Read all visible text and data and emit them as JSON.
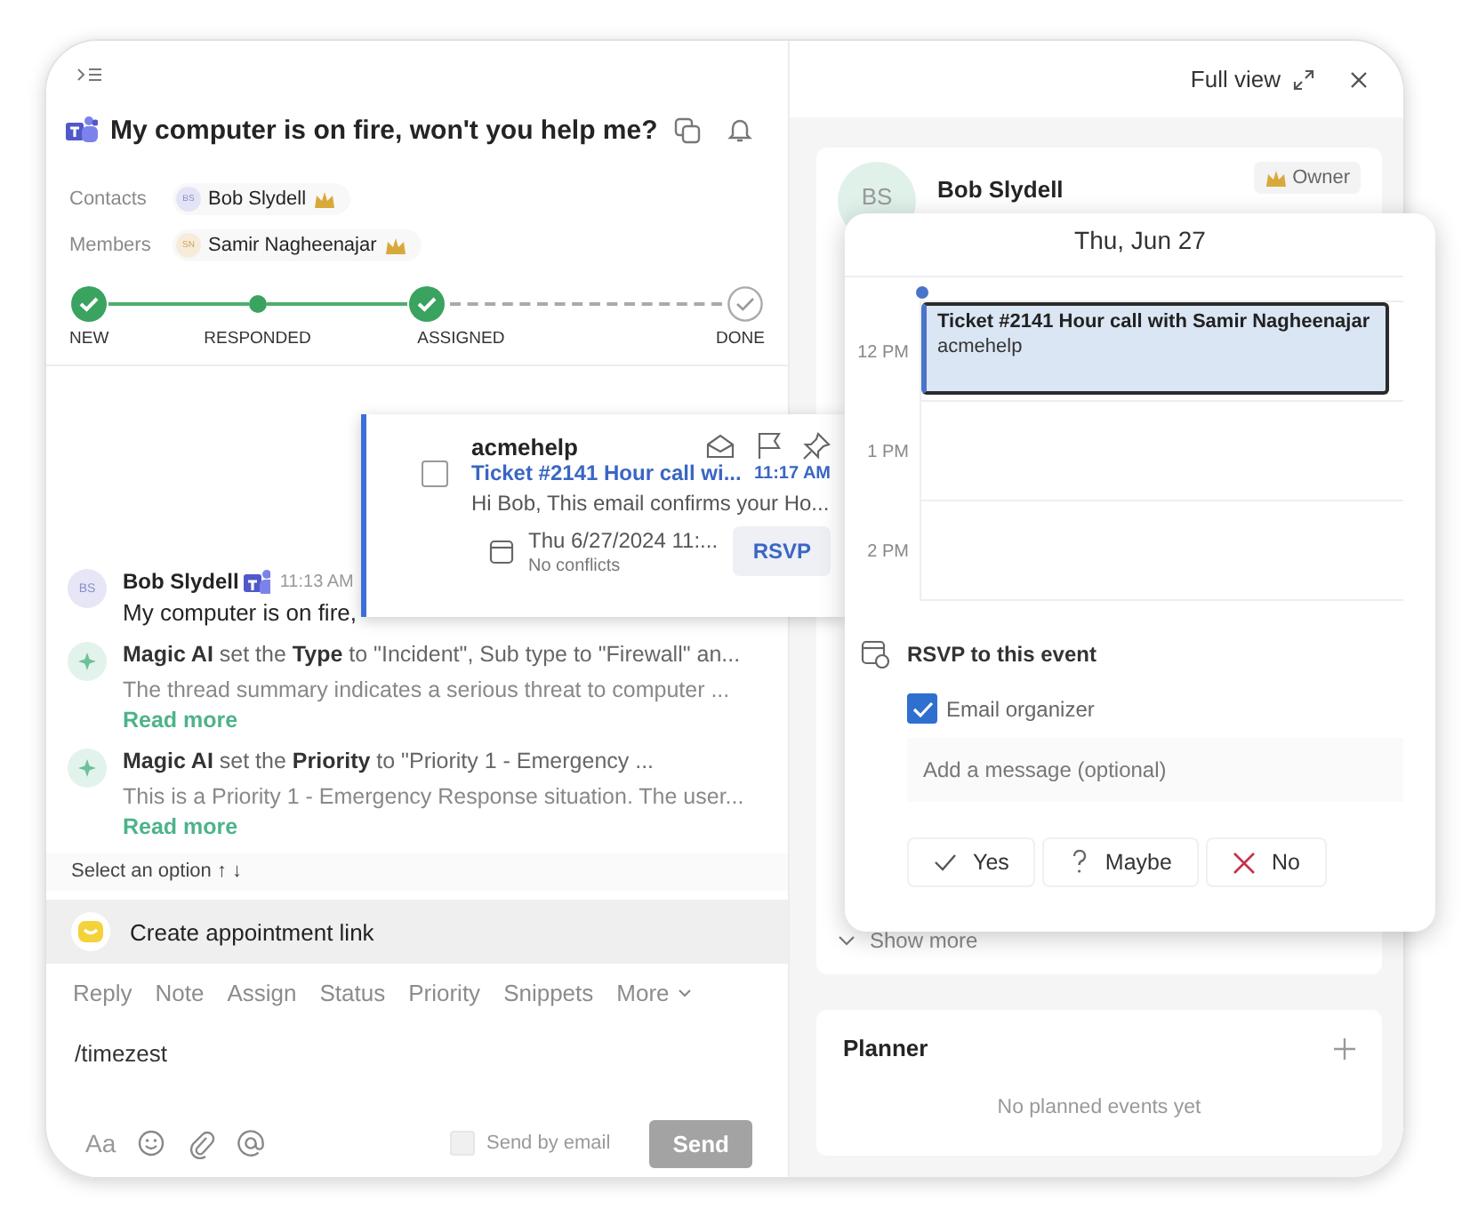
{
  "ticket": {
    "title": "My computer is on fire, won't you help me?",
    "people": [
      {
        "label": "Contacts",
        "initials": "BS",
        "name": "Bob Slydell"
      },
      {
        "label": "Members",
        "initials": "SN",
        "name": "Samir Nagheenajar"
      }
    ],
    "steps": [
      {
        "label": "NEW",
        "kind": "check"
      },
      {
        "label": "RESPONDED",
        "kind": "dot"
      },
      {
        "label": "ASSIGNED",
        "kind": "check"
      },
      {
        "label": "DONE",
        "kind": "pending"
      }
    ]
  },
  "messages": [
    {
      "kind": "user",
      "initials": "BS",
      "author": "Bob Slydell",
      "time": "11:13 AM",
      "text": "My computer is on fire,"
    },
    {
      "kind": "ai",
      "text": "**Magic AI** set the **Type** to \"Incident\", Sub type to \"Firewall\" an...",
      "summary": "The thread summary indicates a serious threat to computer ...",
      "link": "Read more"
    },
    {
      "kind": "ai",
      "text": "**Magic AI** set the **Priority** to \"Priority 1 - Emergency ...",
      "summary": "This is a Priority 1 - Emergency Response situation. The user...",
      "link": "Read more"
    }
  ],
  "option_hint": "Select an option ↑ ↓",
  "suggestion": "Create appointment link",
  "composer": {
    "tabs": [
      "Reply",
      "Note",
      "Assign",
      "Status",
      "Priority",
      "Snippets"
    ],
    "more": "More",
    "value": "/timezest",
    "format": "Aa",
    "send_by_email": {
      "label": "Send by email",
      "checked": false
    },
    "send": {
      "label": "Send",
      "disabled": true
    }
  },
  "right_panel": {
    "full_view": "Full view",
    "contact": {
      "initials": "BS",
      "name": "Bob Slydell",
      "role": "Owner"
    },
    "show_more": "Show more",
    "planner": {
      "title": "Planner",
      "empty": "No planned events yet"
    }
  },
  "email_card": {
    "checked": false,
    "sender": "acmehelp",
    "subject": "Ticket #2141 Hour call wi...",
    "time": "11:17 AM",
    "preview": "Hi Bob, This email confirms your Ho...",
    "date": "Thu 6/27/2024 11:...",
    "conflicts": "No conflicts",
    "rsvp": "RSVP"
  },
  "calendar": {
    "date": "Thu, Jun 27",
    "hours": [
      "12 PM",
      "1 PM",
      "2 PM"
    ],
    "event": {
      "title": "Ticket #2141 Hour call with Samir Nagheenajar",
      "organizer": "acmehelp"
    },
    "rsvp_title": "RSVP to this event",
    "email_organizer": {
      "label": "Email organizer",
      "checked": true
    },
    "message_placeholder": "Add a message (optional)",
    "responses": [
      {
        "kind": "yes",
        "label": "Yes"
      },
      {
        "kind": "maybe",
        "label": "Maybe"
      },
      {
        "kind": "no",
        "label": "No"
      }
    ]
  }
}
